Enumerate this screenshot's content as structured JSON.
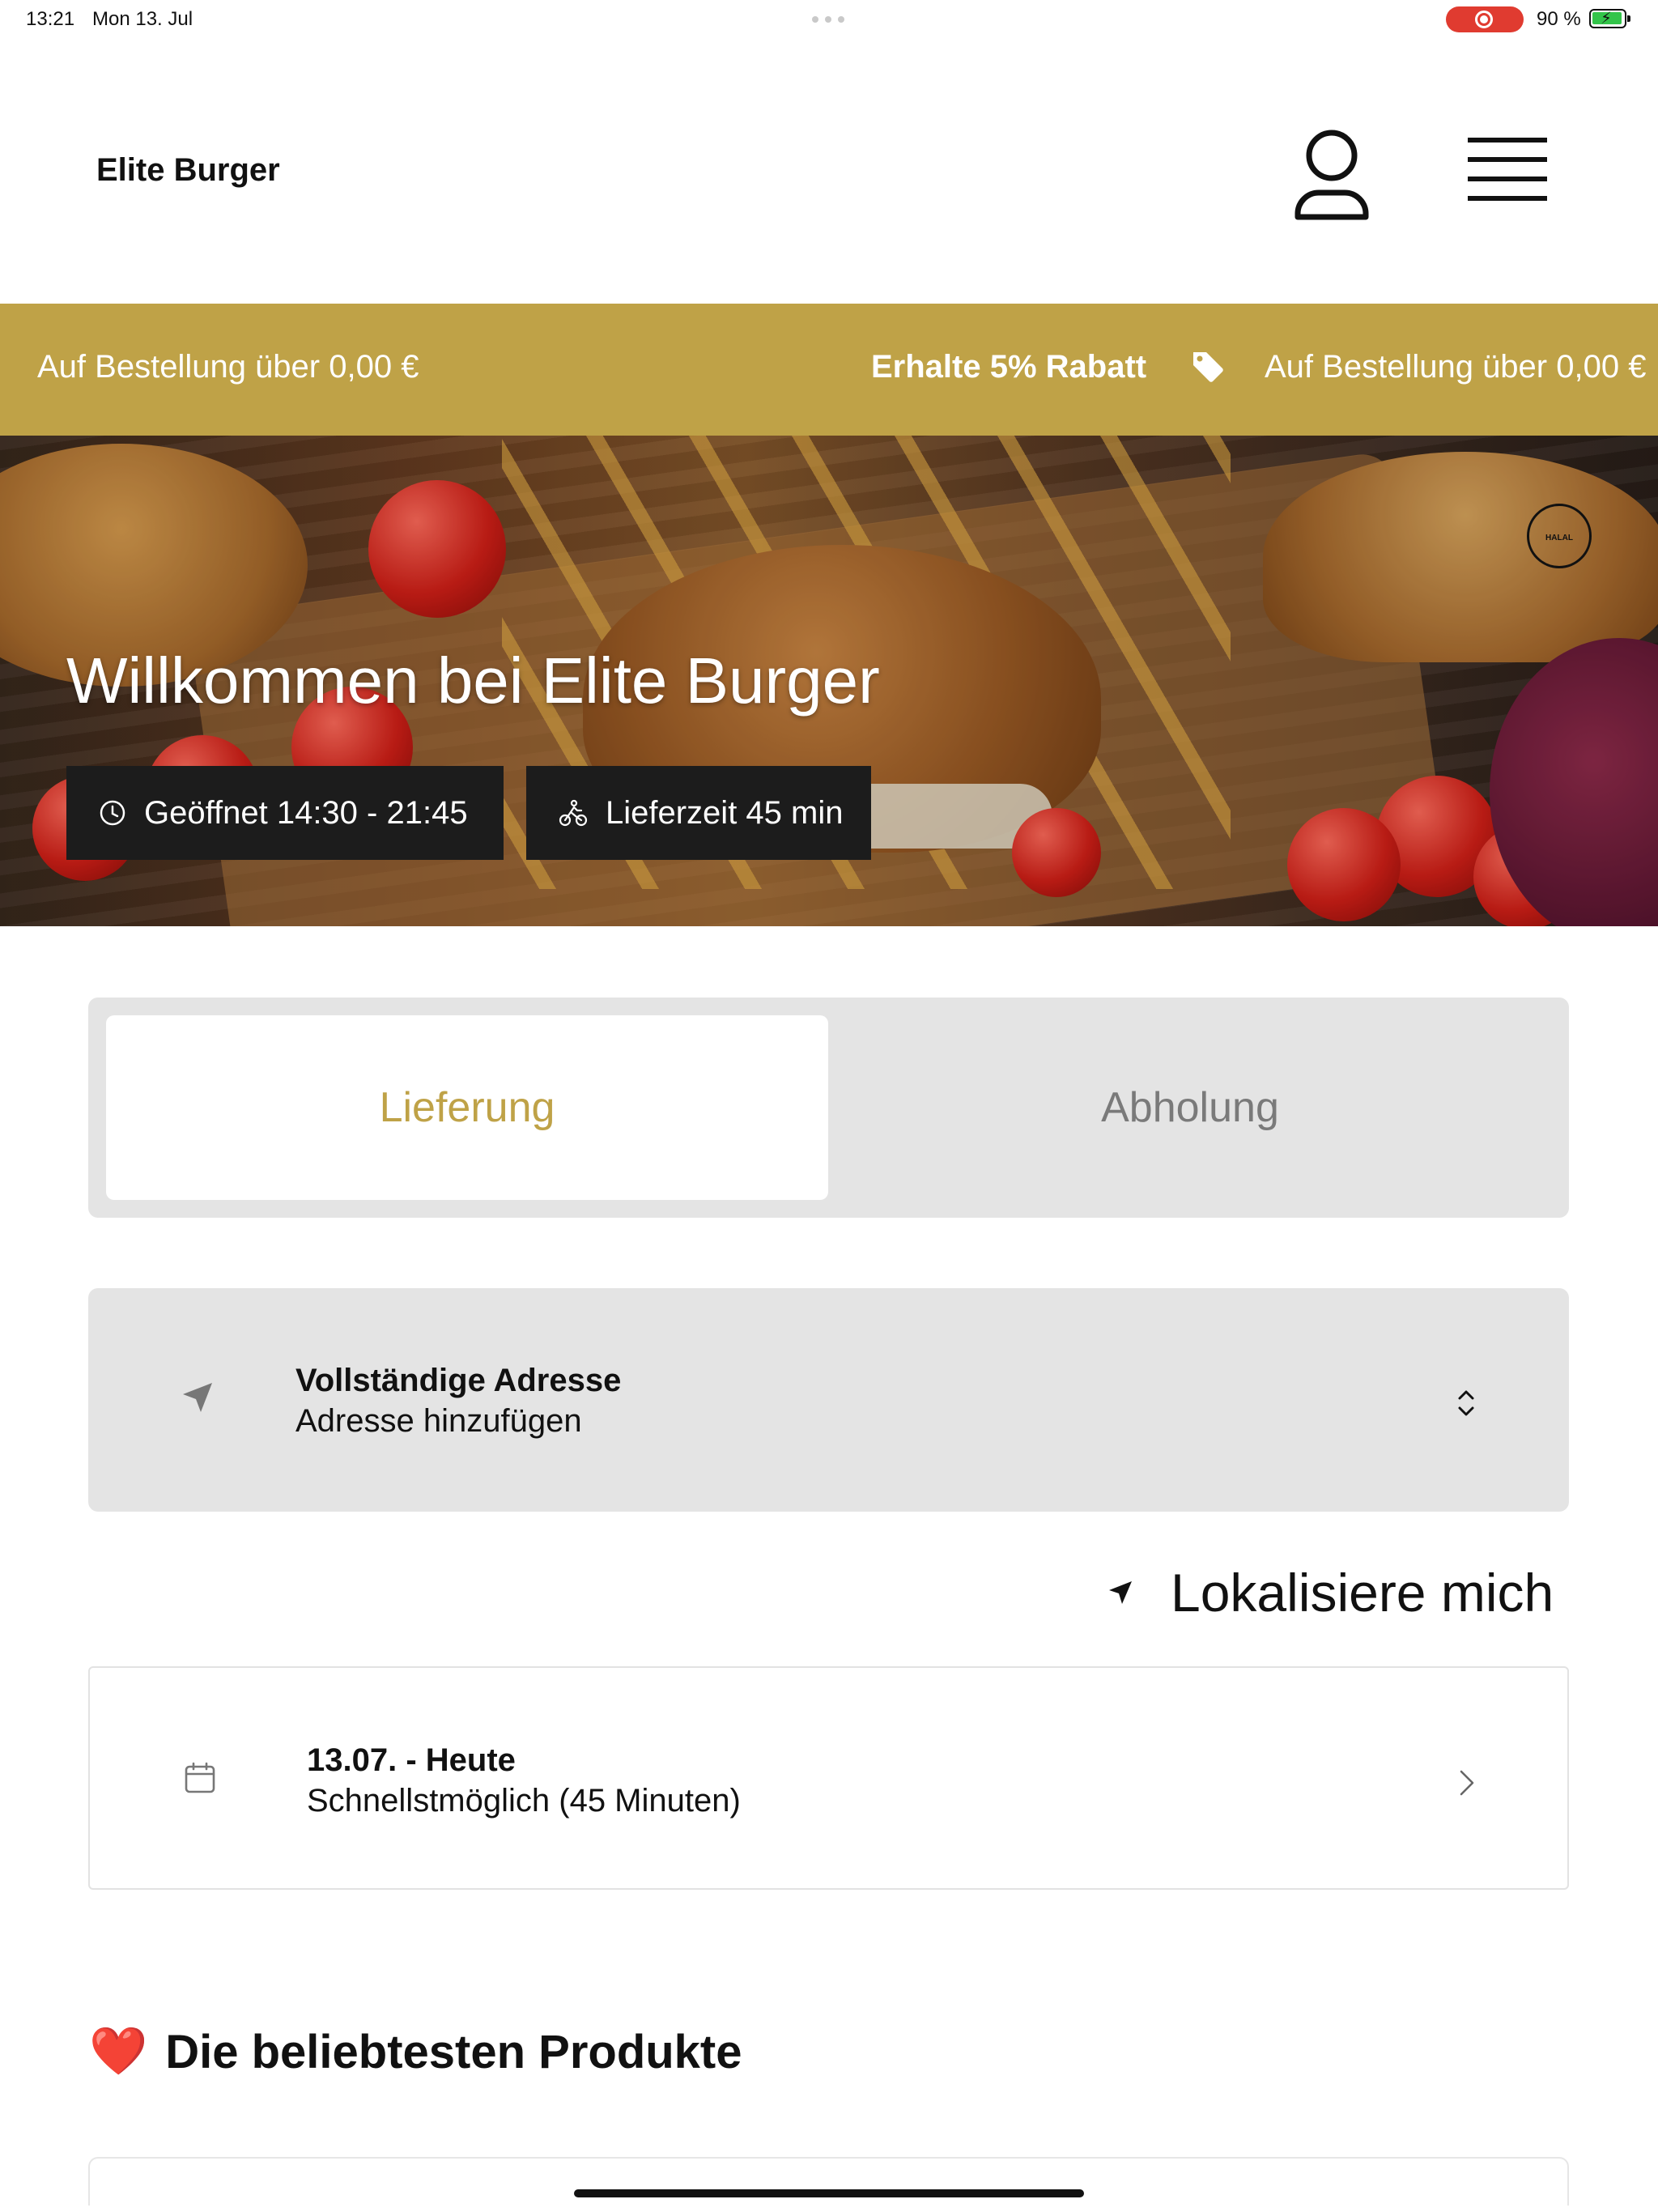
{
  "status_bar": {
    "time": "13:21",
    "date": "Mon 13. Jul",
    "battery_percent": "90 %",
    "battery_charging": true,
    "screen_recording": true
  },
  "header": {
    "brand": "Elite Burger",
    "account_icon": "user-icon",
    "menu_icon": "hamburger-menu-icon"
  },
  "promo": {
    "text_left": "Auf Bestellung über 0,00 €",
    "highlight": "Erhalte 5% Rabatt",
    "tag_icon": "tag-icon",
    "text_right": "Auf Bestellung über 0,00 €",
    "background": "#bfa247"
  },
  "hero": {
    "title": "Willkommen bei Elite Burger",
    "badge": "HALAL",
    "open_hours": "Geöffnet 14:30 - 21:45",
    "delivery_time": "Lieferzeit 45 min"
  },
  "order_type": {
    "options": [
      "Lieferung",
      "Abholung"
    ],
    "selected": "Lieferung",
    "accent": "#bfa247"
  },
  "address": {
    "title": "Vollständige Adresse",
    "placeholder": "Adresse hinzufügen"
  },
  "locate": {
    "label": "Lokalisiere mich"
  },
  "schedule": {
    "date": "13.07. - Heute",
    "time": "Schnellstmöglich (45 Minuten)"
  },
  "popular": {
    "heading": "Die beliebtesten Produkte",
    "emoji": "❤️"
  }
}
